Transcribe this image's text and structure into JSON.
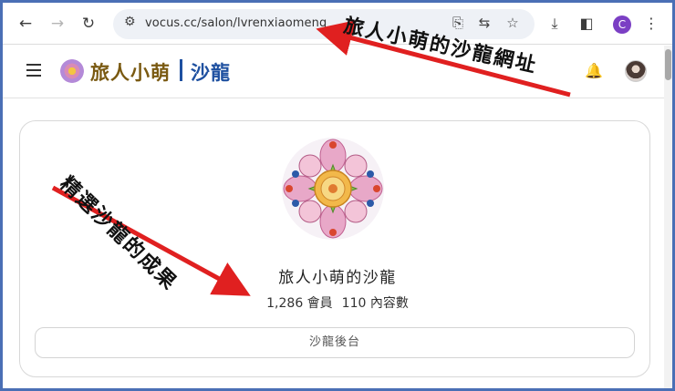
{
  "browser": {
    "url": "vocus.cc/salon/lvrenxiaomeng",
    "profile_initial": "C",
    "icons": [
      "back-icon",
      "forward-icon",
      "reload-icon",
      "tune-icon",
      "install-icon",
      "translate-icon",
      "star-icon",
      "download-icon",
      "sidepanel-icon",
      "menu-dots-icon"
    ]
  },
  "site": {
    "title": "旅人小萌",
    "subtitle": "沙龍",
    "brand_color": "#1e50a0",
    "title_color": "#7a5a12"
  },
  "salon": {
    "name": "旅人小萌的沙龍",
    "members": "1,286 會員",
    "contents": "110 內容數",
    "admin_button": "沙龍後台"
  },
  "annotations": {
    "url_note": "旅人小萌的沙龍網址",
    "result_note": "精選沙龍的成果",
    "arrow_color": "#e02020"
  }
}
